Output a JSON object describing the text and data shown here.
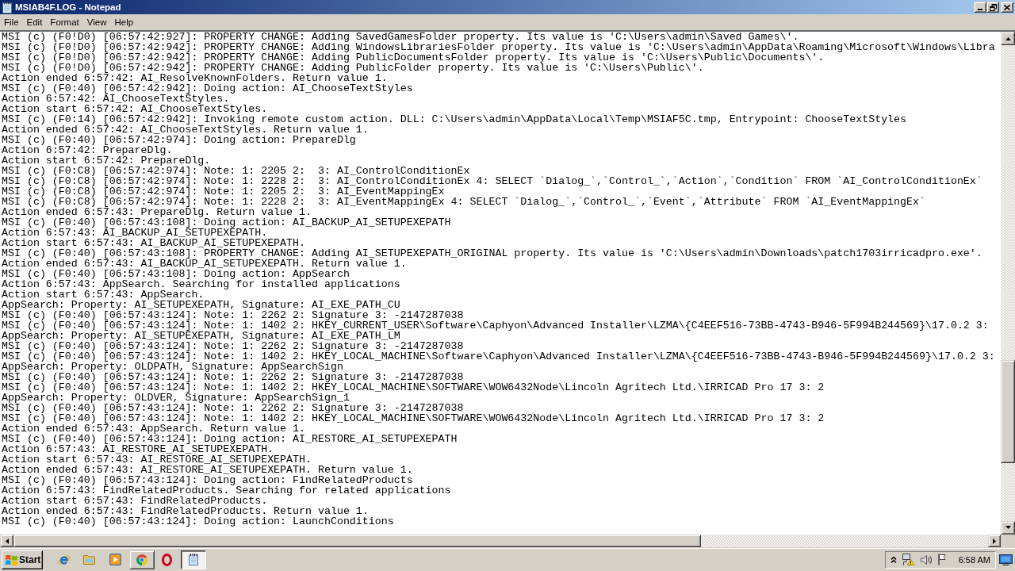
{
  "window": {
    "title": "MSIAB4F.LOG - Notepad"
  },
  "menu": [
    "File",
    "Edit",
    "Format",
    "View",
    "Help"
  ],
  "editor": {
    "lines": [
      "MSI (c) (F0!D0) [06:57:42:927]: PROPERTY CHANGE: Adding SavedGamesFolder property. Its value is 'C:\\Users\\admin\\Saved Games\\'.",
      "MSI (c) (F0!D0) [06:57:42:942]: PROPERTY CHANGE: Adding WindowsLibrariesFolder property. Its value is 'C:\\Users\\admin\\AppData\\Roaming\\Microsoft\\Windows\\Libra",
      "MSI (c) (F0!D0) [06:57:42:942]: PROPERTY CHANGE: Adding PublicDocumentsFolder property. Its value is 'C:\\Users\\Public\\Documents\\'.",
      "MSI (c) (F0!D0) [06:57:42:942]: PROPERTY CHANGE: Adding PublicFolder property. Its value is 'C:\\Users\\Public\\'.",
      "Action ended 6:57:42: AI_ResolveKnownFolders. Return value 1.",
      "MSI (c) (F0:40) [06:57:42:942]: Doing action: AI_ChooseTextStyles",
      "Action 6:57:42: AI_ChooseTextStyles.",
      "Action start 6:57:42: AI_ChooseTextStyles.",
      "MSI (c) (F0:14) [06:57:42:942]: Invoking remote custom action. DLL: C:\\Users\\admin\\AppData\\Local\\Temp\\MSIAF5C.tmp, Entrypoint: ChooseTextStyles",
      "Action ended 6:57:42: AI_ChooseTextStyles. Return value 1.",
      "MSI (c) (F0:40) [06:57:42:974]: Doing action: PrepareDlg",
      "Action 6:57:42: PrepareDlg.",
      "Action start 6:57:42: PrepareDlg.",
      "MSI (c) (F0:C8) [06:57:42:974]: Note: 1: 2205 2:  3: AI_ControlConditionEx",
      "MSI (c) (F0:C8) [06:57:42:974]: Note: 1: 2228 2:  3: AI_ControlConditionEx 4: SELECT `Dialog_`,`Control_`,`Action`,`Condition` FROM `AI_ControlConditionEx`",
      "MSI (c) (F0:C8) [06:57:42:974]: Note: 1: 2205 2:  3: AI_EventMappingEx",
      "MSI (c) (F0:C8) [06:57:42:974]: Note: 1: 2228 2:  3: AI_EventMappingEx 4: SELECT `Dialog_`,`Control_`,`Event`,`Attribute` FROM `AI_EventMappingEx`",
      "Action ended 6:57:43: PrepareDlg. Return value 1.",
      "MSI (c) (F0:40) [06:57:43:108]: Doing action: AI_BACKUP_AI_SETUPEXEPATH",
      "Action 6:57:43: AI_BACKUP_AI_SETUPEXEPATH.",
      "Action start 6:57:43: AI_BACKUP_AI_SETUPEXEPATH.",
      "MSI (c) (F0:40) [06:57:43:108]: PROPERTY CHANGE: Adding AI_SETUPEXEPATH_ORIGINAL property. Its value is 'C:\\Users\\admin\\Downloads\\patch1703irricadpro.exe'.",
      "Action ended 6:57:43: AI_BACKUP_AI_SETUPEXEPATH. Return value 1.",
      "MSI (c) (F0:40) [06:57:43:108]: Doing action: AppSearch",
      "Action 6:57:43: AppSearch. Searching for installed applications",
      "Action start 6:57:43: AppSearch.",
      "AppSearch: Property: AI_SETUPEXEPATH, Signature: AI_EXE_PATH_CU",
      "MSI (c) (F0:40) [06:57:43:124]: Note: 1: 2262 2: Signature 3: -2147287038",
      "MSI (c) (F0:40) [06:57:43:124]: Note: 1: 1402 2: HKEY_CURRENT_USER\\Software\\Caphyon\\Advanced Installer\\LZMA\\{C4EEF516-73BB-4743-B946-5F994B244569}\\17.0.2 3:",
      "AppSearch: Property: AI_SETUPEXEPATH, Signature: AI_EXE_PATH_LM",
      "MSI (c) (F0:40) [06:57:43:124]: Note: 1: 2262 2: Signature 3: -2147287038",
      "MSI (c) (F0:40) [06:57:43:124]: Note: 1: 1402 2: HKEY_LOCAL_MACHINE\\Software\\Caphyon\\Advanced Installer\\LZMA\\{C4EEF516-73BB-4743-B946-5F994B244569}\\17.0.2 3:",
      "AppSearch: Property: OLDPATH, Signature: AppSearchSign",
      "MSI (c) (F0:40) [06:57:43:124]: Note: 1: 2262 2: Signature 3: -2147287038",
      "MSI (c) (F0:40) [06:57:43:124]: Note: 1: 1402 2: HKEY_LOCAL_MACHINE\\SOFTWARE\\WOW6432Node\\Lincoln Agritech Ltd.\\IRRICAD Pro 17 3: 2",
      "AppSearch: Property: OLDVER, Signature: AppSearchSign_1",
      "MSI (c) (F0:40) [06:57:43:124]: Note: 1: 2262 2: Signature 3: -2147287038",
      "MSI (c) (F0:40) [06:57:43:124]: Note: 1: 1402 2: HKEY_LOCAL_MACHINE\\SOFTWARE\\WOW6432Node\\Lincoln Agritech Ltd.\\IRRICAD Pro 17 3: 2",
      "Action ended 6:57:43: AppSearch. Return value 1.",
      "MSI (c) (F0:40) [06:57:43:124]: Doing action: AI_RESTORE_AI_SETUPEXEPATH",
      "Action 6:57:43: AI_RESTORE_AI_SETUPEXEPATH.",
      "Action start 6:57:43: AI_RESTORE_AI_SETUPEXEPATH.",
      "Action ended 6:57:43: AI_RESTORE_AI_SETUPEXEPATH. Return value 1.",
      "MSI (c) (F0:40) [06:57:43:124]: Doing action: FindRelatedProducts",
      "Action 6:57:43: FindRelatedProducts. Searching for related applications",
      "Action start 6:57:43: FindRelatedProducts.",
      "Action ended 6:57:43: FindRelatedProducts. Return value 1.",
      "MSI (c) (F0:40) [06:57:43:124]: Doing action: LaunchConditions"
    ]
  },
  "taskbar": {
    "start_button": "Start",
    "buttons": [
      {
        "kind": "browser",
        "selected": false
      },
      {
        "kind": "notepad",
        "selected": true
      }
    ],
    "clock": "6:58 AM"
  }
}
